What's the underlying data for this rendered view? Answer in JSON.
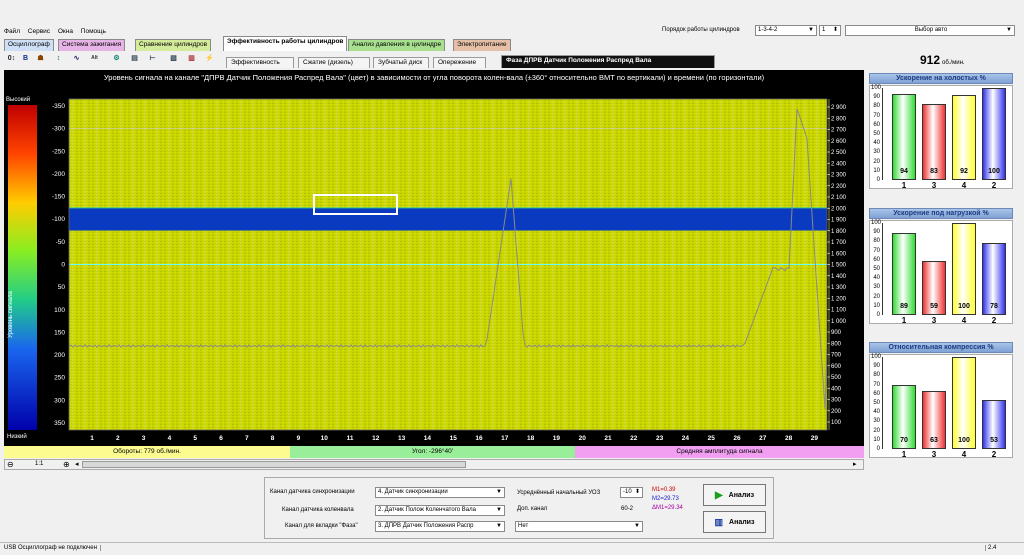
{
  "menu": [
    "Файл",
    "Сервис",
    "Окна",
    "Помощь"
  ],
  "top_right": {
    "order_label": "Порядок работы цилиндров",
    "order_value": "1-3-4-2",
    "stepper_value": "1",
    "car_select": "Выбор авто"
  },
  "tabs_top": [
    "Осциллограф",
    "Система зажигания",
    "Сравнение цилиндров",
    "Эффективность работы цилиндров",
    "Анализ давления в цилиндре",
    "Электропитание"
  ],
  "toolbar_icons": [
    "0↕",
    "B",
    "☗",
    "↕",
    "∿",
    "Alt",
    "⚙",
    "▤",
    "⊢",
    "▧",
    "▥",
    "⚡"
  ],
  "tabs_sub": [
    "Эффективность",
    "Сжатие (дизель)",
    "Зубчатый диск",
    "Опережение",
    "Фаза ДПРВ Датчик Положения Распред Вала"
  ],
  "rpm_value": "912",
  "rpm_unit": "об./мин.",
  "heatmap": {
    "title": "Уровень сигнала на канале \"ДПРВ Датчик Положения Распред Вала\" (цвет) в зависимости от угла поворота колен-вала (±360° относительно ВМТ по вертикали) и времени (по горизонтали)",
    "colorbar_high": "Высокий",
    "colorbar_low": "Низкий",
    "colorbar_label": "Уровень сигнала",
    "y_ticks": [
      "-350",
      "-300",
      "-250",
      "-200",
      "-150",
      "-100",
      "-50",
      "0",
      "50",
      "100",
      "150",
      "200",
      "250",
      "300",
      "350"
    ],
    "x_ticks": [
      "1",
      "2",
      "3",
      "4",
      "5",
      "6",
      "7",
      "8",
      "9",
      "10",
      "11",
      "12",
      "13",
      "14",
      "15",
      "16",
      "17",
      "18",
      "19",
      "20",
      "21",
      "22",
      "23",
      "24",
      "25",
      "26",
      "27",
      "28",
      "29"
    ],
    "r_ticks": [
      "2 900",
      "2 800",
      "2 700",
      "2 600",
      "2 500",
      "2 400",
      "2 300",
      "2 200",
      "2 100",
      "2 000",
      "1 900",
      "1 800",
      "1 700",
      "1 600",
      "1 500",
      "1 400",
      "1 300",
      "1 200",
      "1 100",
      "1 000",
      "900",
      "800",
      "700",
      "600",
      "500",
      "400",
      "300",
      "200",
      "100"
    ],
    "status_rpm": "Обороты: 779 об./мин.",
    "status_angle": "Угол: -296°40'",
    "status_amp": "Средняя амплитуда сигнала"
  },
  "scroll": {
    "scale": "1:1"
  },
  "bottom": {
    "sync_label": "Канал датчика синхронизации",
    "sync_value": "4. Датчик синхронизации",
    "crank_label": "Канал датчика коленвала",
    "crank_value": "2. Датчик Полож Коленчатого Вала",
    "phase_label": "Канал для вкладки \"Фаза\"",
    "phase_value": "3. ДПРВ Датчик Положения Распр",
    "uoz_label": "Усреднённый начальный УОЗ",
    "uoz_value": "-10",
    "dop_label": "Доп. канал",
    "dop_value": "60-2",
    "dop_select": "Нет",
    "m1": "M1=0.39",
    "m2": "M2=29.73",
    "dm": "ΔM1=29.34",
    "analyze1": "Анализ",
    "analyze2": "Анализ"
  },
  "statusbar": {
    "left": "USB Осциллограф не подключен",
    "right": "2.4"
  },
  "panels": [
    {
      "title": "Ускорение на холостых %",
      "values": [
        94,
        83,
        92,
        100
      ]
    },
    {
      "title": "Ускорение под нагрузкой %",
      "values": [
        89,
        59,
        100,
        78
      ]
    },
    {
      "title": "Относительная компрессия %",
      "values": [
        70,
        63,
        100,
        53
      ]
    }
  ],
  "cyl_labels": [
    "1",
    "3",
    "4",
    "2"
  ],
  "axis_ticks": [
    "100",
    "90",
    "80",
    "70",
    "60",
    "50",
    "40",
    "30",
    "20",
    "10",
    "0"
  ],
  "bar_colors": [
    "#33dd33",
    "#ee3333",
    "#ffff33",
    "#3333ee"
  ]
}
